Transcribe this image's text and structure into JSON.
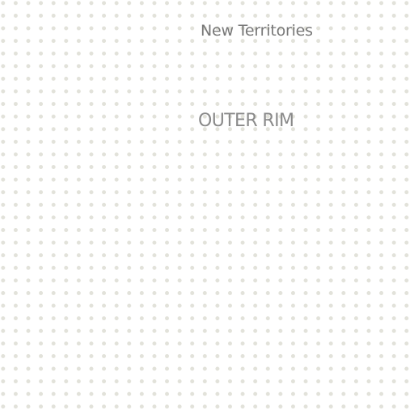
{
  "map": {
    "region_label": "New Territories",
    "zone_label": "OUTER RIM"
  },
  "colors": {
    "background": "#ffffff",
    "dot": "#e2e2da",
    "region_label": "#777777",
    "zone_label": "#8a8a8a"
  }
}
